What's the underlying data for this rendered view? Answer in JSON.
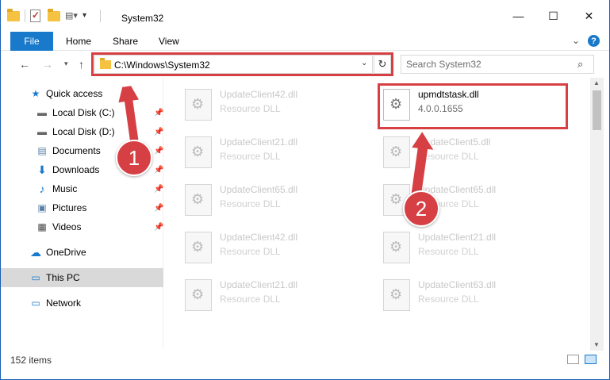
{
  "window": {
    "title": "System32",
    "controls": {
      "minimize": "—",
      "maximize": "☐",
      "close": "✕"
    }
  },
  "ribbon": {
    "tabs": [
      "File",
      "Home",
      "Share",
      "View"
    ],
    "help": "?"
  },
  "nav": {
    "address": "C:\\Windows\\System32",
    "search_placeholder": "Search System32"
  },
  "sidebar": {
    "items": [
      {
        "label": "Quick access",
        "icon": "star-icon",
        "pinned": false
      },
      {
        "label": "Local Disk (C:)",
        "icon": "drive-icon",
        "pinned": true
      },
      {
        "label": "Local Disk (D:)",
        "icon": "drive-icon",
        "pinned": true
      },
      {
        "label": "Documents",
        "icon": "documents-icon",
        "pinned": true
      },
      {
        "label": "Downloads",
        "icon": "download-icon",
        "pinned": true
      },
      {
        "label": "Music",
        "icon": "music-icon",
        "pinned": true
      },
      {
        "label": "Pictures",
        "icon": "pictures-icon",
        "pinned": true
      },
      {
        "label": "Videos",
        "icon": "videos-icon",
        "pinned": true
      },
      {
        "label": "OneDrive",
        "icon": "cloud-icon",
        "pinned": false
      },
      {
        "label": "This PC",
        "icon": "computer-icon",
        "pinned": false
      },
      {
        "label": "Network",
        "icon": "network-icon",
        "pinned": false
      }
    ]
  },
  "files": [
    {
      "name": "UpdateClient42.dll",
      "type": "Resource DLL"
    },
    {
      "name": "upmdtstask.dll",
      "type": "4.0.0.1655"
    },
    {
      "name": "UpdateClient21.dll",
      "type": "Resource DLL"
    },
    {
      "name": "UpdateClient5.dll",
      "type": "Resource DLL"
    },
    {
      "name": "UpdateClient65.dll",
      "type": "Resource DLL"
    },
    {
      "name": "UpdateClient65.dll",
      "type": "Resource DLL"
    },
    {
      "name": "UpdateClient42.dll",
      "type": "Resource DLL"
    },
    {
      "name": "UpdateClient21.dll",
      "type": "Resource DLL"
    },
    {
      "name": "UpdateClient21.dll",
      "type": "Resource DLL"
    },
    {
      "name": "UpdateClient63.dll",
      "type": "Resource DLL"
    }
  ],
  "status": {
    "count": "152 items"
  },
  "callouts": [
    "1",
    "2"
  ],
  "colors": {
    "accent": "#1979ca",
    "highlight": "#d64045"
  }
}
